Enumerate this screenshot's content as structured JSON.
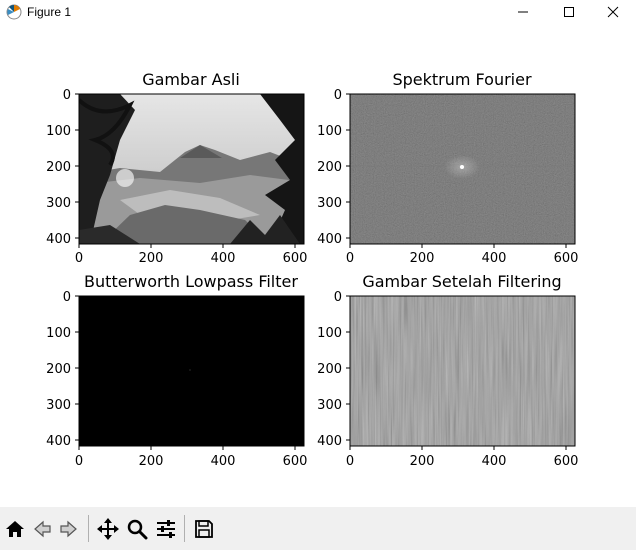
{
  "window": {
    "title": "Figure 1",
    "icon": "matplotlib-icon",
    "controls": [
      "minimize-icon",
      "maximize-icon",
      "close-icon"
    ]
  },
  "figure": {
    "subplots": [
      {
        "title": "Gambar Asli",
        "image": "grayscale landscape photo (Mount Bromo with trees)",
        "xticks": [
          "0",
          "200",
          "400",
          "600"
        ],
        "yticks": [
          "0",
          "100",
          "200",
          "300",
          "400"
        ],
        "xlim": [
          0,
          625
        ],
        "ylim": [
          417,
          0
        ]
      },
      {
        "title": "Spektrum Fourier",
        "image": "gray noise magnitude spectrum with bright center",
        "xticks": [
          "0",
          "200",
          "400",
          "600"
        ],
        "yticks": [
          "0",
          "100",
          "200",
          "300",
          "400"
        ],
        "xlim": [
          0,
          625
        ],
        "ylim": [
          417,
          0
        ]
      },
      {
        "title": "Butterworth Lowpass Filter",
        "image": "black filter mask",
        "xticks": [
          "0",
          "200",
          "400",
          "600"
        ],
        "yticks": [
          "0",
          "100",
          "200",
          "300",
          "400"
        ],
        "xlim": [
          0,
          625
        ],
        "ylim": [
          417,
          0
        ]
      },
      {
        "title": "Gambar Setelah Filtering",
        "image": "gray striped filtered image",
        "xticks": [
          "0",
          "200",
          "400",
          "600"
        ],
        "yticks": [
          "0",
          "100",
          "200",
          "300",
          "400"
        ],
        "xlim": [
          0,
          625
        ],
        "ylim": [
          417,
          0
        ]
      }
    ]
  },
  "toolbar": {
    "buttons": [
      "home-icon",
      "back-icon",
      "forward-icon",
      "pan-icon",
      "zoom-icon",
      "configure-subplots-icon",
      "save-icon"
    ]
  }
}
